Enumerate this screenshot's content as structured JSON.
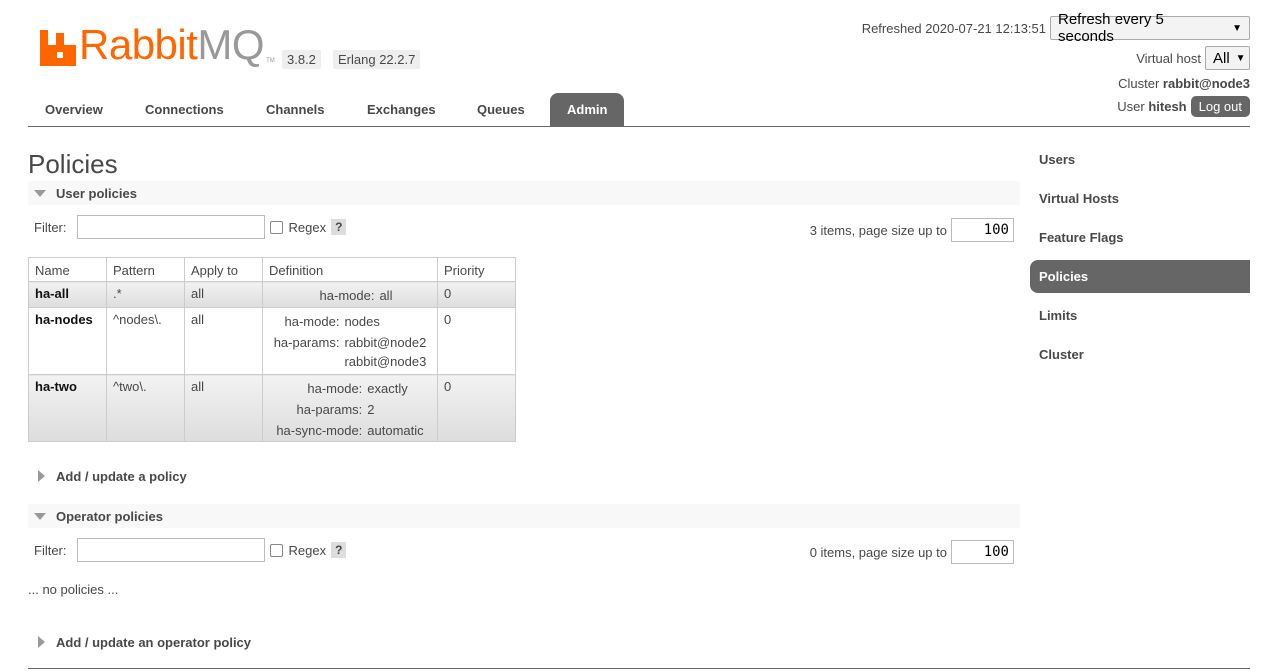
{
  "header": {
    "logo": {
      "part1": "Rabbit",
      "part2": "MQ",
      "tm": "TM"
    },
    "version": "3.8.2",
    "erlang": "Erlang 22.2.7",
    "refreshed": "Refreshed 2020-07-21 12:13:51",
    "refresh_select": "Refresh every 5 seconds",
    "vhost_label": "Virtual host",
    "vhost_value": "All",
    "cluster_label": "Cluster",
    "cluster_value": "rabbit@node3",
    "user_label": "User",
    "user_value": "hitesh",
    "logout_label": "Log out"
  },
  "tabs": [
    {
      "label": "Overview"
    },
    {
      "label": "Connections"
    },
    {
      "label": "Channels"
    },
    {
      "label": "Exchanges"
    },
    {
      "label": "Queues"
    },
    {
      "label": "Admin",
      "active": true
    }
  ],
  "page_title": "Policies",
  "user_policies": {
    "section_label": "User policies",
    "filter_label": "Filter:",
    "regex_label": "Regex",
    "help_label": "?",
    "page_size_label": "3 items, page size up to",
    "page_size_value": "100",
    "columns": [
      "Name",
      "Pattern",
      "Apply to",
      "Definition",
      "Priority"
    ],
    "rows": [
      {
        "name": "ha-all",
        "pattern": ".*",
        "apply_to": "all",
        "priority": "0",
        "definition": [
          {
            "key": "ha-mode:",
            "values": [
              "all"
            ]
          }
        ]
      },
      {
        "name": "ha-nodes",
        "pattern": "^nodes\\.",
        "apply_to": "all",
        "priority": "0",
        "definition": [
          {
            "key": "ha-mode:",
            "values": [
              "nodes"
            ]
          },
          {
            "key": "ha-params:",
            "values": [
              "rabbit@node2",
              "rabbit@node3"
            ]
          }
        ]
      },
      {
        "name": "ha-two",
        "pattern": "^two\\.",
        "apply_to": "all",
        "priority": "0",
        "definition": [
          {
            "key": "ha-mode:",
            "values": [
              "exactly"
            ]
          },
          {
            "key": "ha-params:",
            "values": [
              "2"
            ]
          },
          {
            "key": "ha-sync-mode:",
            "values": [
              "automatic"
            ]
          }
        ]
      }
    ]
  },
  "add_policy_label": "Add / update a policy",
  "operator_policies": {
    "section_label": "Operator policies",
    "filter_label": "Filter:",
    "regex_label": "Regex",
    "help_label": "?",
    "page_size_label": "0 items, page size up to",
    "page_size_value": "100",
    "empty_text": "... no policies ..."
  },
  "add_operator_policy_label": "Add / update an operator policy",
  "sidenav": [
    {
      "label": "Users"
    },
    {
      "label": "Virtual Hosts"
    },
    {
      "label": "Feature Flags"
    },
    {
      "label": "Policies",
      "active": true
    },
    {
      "label": "Limits"
    },
    {
      "label": "Cluster"
    }
  ],
  "colors": {
    "brand": "#ff6600",
    "active_tab": "#666666"
  }
}
